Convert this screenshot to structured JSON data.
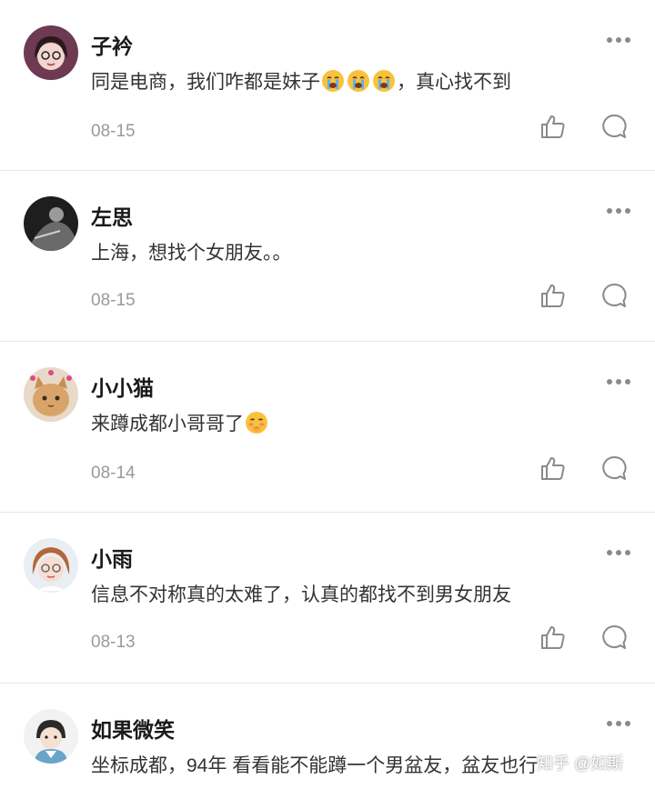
{
  "comments": [
    {
      "name": "子衿",
      "content": "同是电商，我们咋都是妹子",
      "content_emoji": [
        "loudly-crying-face-emoji",
        "loudly-crying-face-emoji",
        "loudly-crying-face-emoji"
      ],
      "content_tail": "，真心找不到",
      "date": "08-15"
    },
    {
      "name": "左思",
      "content": "上海，想找个女朋友。。",
      "date": "08-15"
    },
    {
      "name": "小小猫",
      "content": "来蹲成都小哥哥了",
      "content_emoji": [
        "flushed-shy-face-emoji"
      ],
      "date": "08-14"
    },
    {
      "name": "小雨",
      "content": "信息不对称真的太难了，认真的都找不到男女朋友",
      "date": "08-13"
    },
    {
      "name": "如果微笑",
      "content": "坐标成都，94年 看看能不能蹲一个男盆友，盆友也行"
    }
  ],
  "watermark": "知乎 @如斯",
  "icons": {
    "more": "more-dots-icon",
    "like": "thumbs-up-icon",
    "reply": "reply-bubble-icon"
  },
  "colors": {
    "name": "#1a1a1a",
    "content": "#333333",
    "date": "#9a9a9a",
    "icon": "#8a8a8a",
    "divider": "#e6e6e6"
  }
}
